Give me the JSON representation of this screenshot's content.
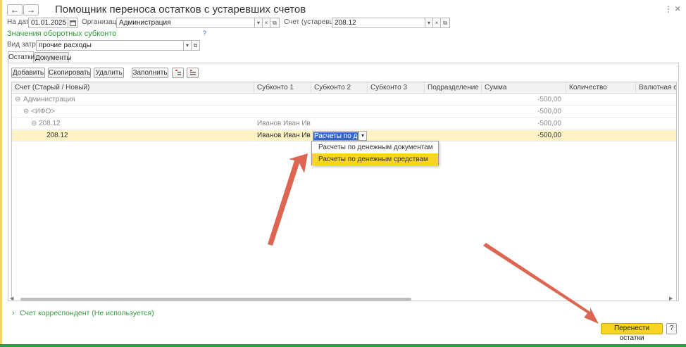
{
  "window": {
    "title": "Помощник переноса остатков с устаревших счетов",
    "back_glyph": "←",
    "forward_glyph": "→",
    "more_glyph": "⋮",
    "close_glyph": "×"
  },
  "filters": {
    "date_label": "На дату:",
    "date_value": "01.01.2025",
    "org_label": "Организация:",
    "org_value": "Администрация",
    "account_label": "Счет (устаревший):",
    "account_value": "208.12"
  },
  "section": {
    "title": "Значения оборотных субконто",
    "help": "?",
    "cost_type_label": "Вид затрат:",
    "cost_type_value": "прочие расходы"
  },
  "tabs": [
    {
      "label": "Остатки",
      "active": true
    },
    {
      "label": "Документы",
      "active": false
    }
  ],
  "toolbar": {
    "add": "Добавить",
    "copy": "Скопировать",
    "delete": "Удалить",
    "fill": "Заполнить"
  },
  "table": {
    "columns": [
      "Счет (Старый / Новый)",
      "Субконто 1",
      "Субконто 2",
      "Субконто 3",
      "Подразделение",
      "Сумма",
      "Количество",
      "Валютная сумма"
    ],
    "rows": [
      {
        "tree": "⊖",
        "account": "Администрация",
        "sub1": "",
        "sub2": "",
        "sum": "-500,00"
      },
      {
        "tree": "⊖",
        "account": "<ИФО>",
        "sub1": "",
        "sub2": "",
        "sum": "-500,00"
      },
      {
        "tree": "⊖",
        "account": "208.12",
        "sub1": "Иванов Иван Иван...",
        "sub2": "",
        "sum": "-500,00"
      },
      {
        "tree": "",
        "account": "208.12",
        "sub1": "Иванов Иван Иван...",
        "sub2": "Расчеты по дене",
        "sum": "-500,00"
      }
    ]
  },
  "dropdown": {
    "options": [
      "Расчеты по денежным документам",
      "Расчеты по денежным средствам"
    ],
    "highlighted_index": 1
  },
  "footer": {
    "corr_toggle": "›",
    "corr_label": "Счет корреспондент (Не используется)",
    "transfer_button": "Перенести остатки",
    "help_button": "?"
  },
  "colors": {
    "accent_yellow": "#f7d520",
    "selected_row": "#fdf3c4",
    "green": "#2e9e3c",
    "arrow": "#d9553f"
  }
}
